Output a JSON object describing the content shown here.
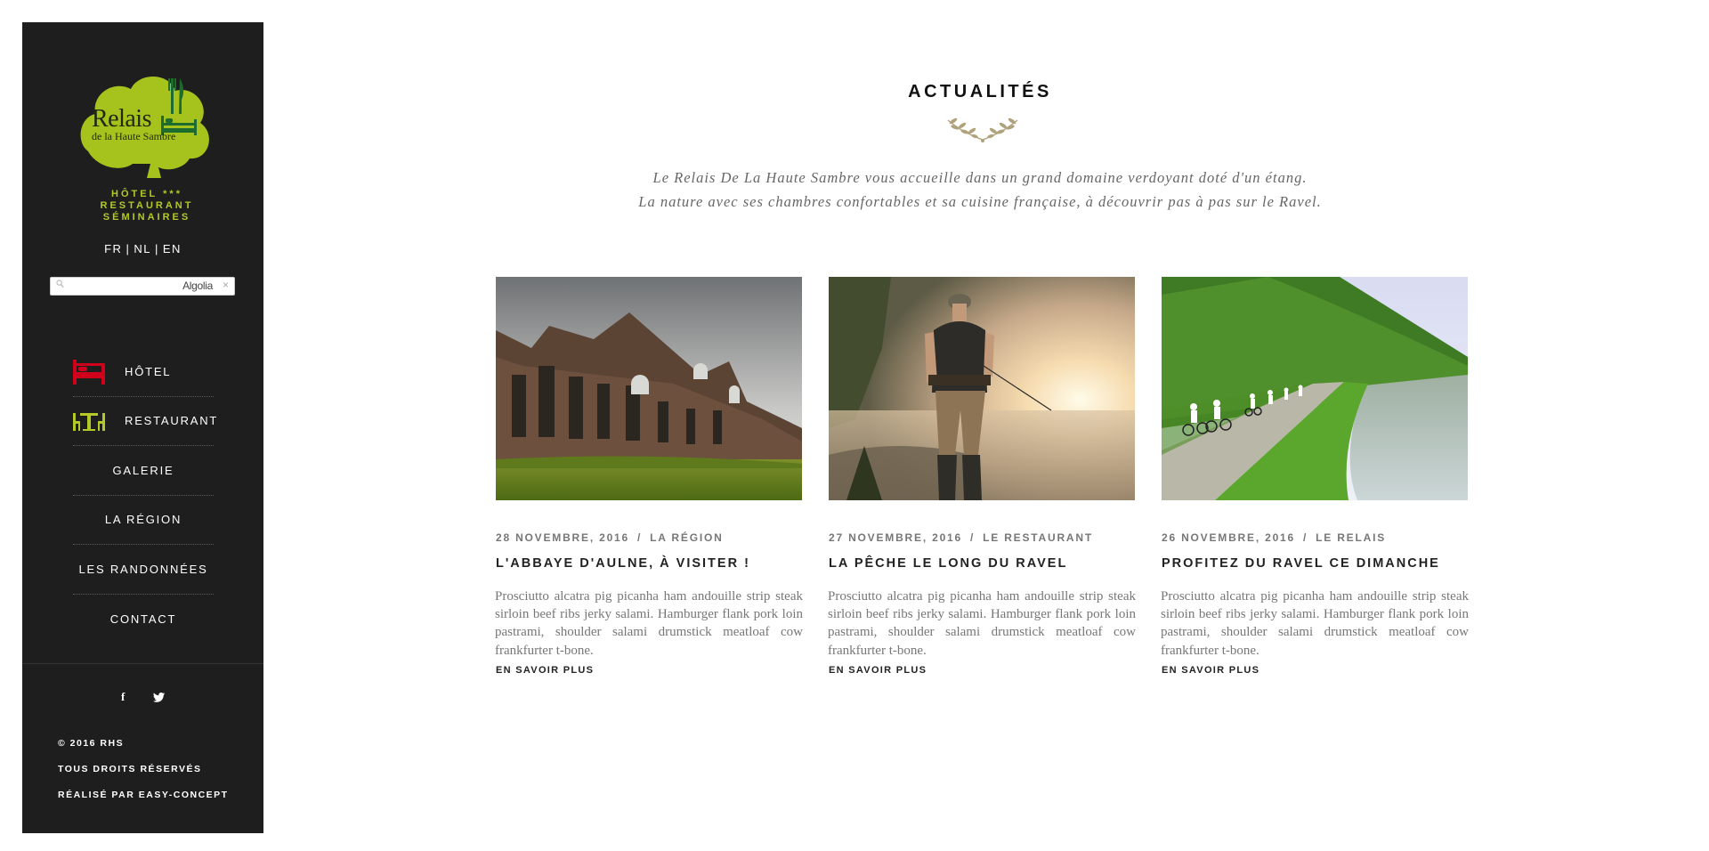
{
  "brand": {
    "logo_main": "Relais",
    "logo_sub": "de la Haute Sambre",
    "tags": [
      "HÔTEL ***",
      "RESTAURANT",
      "SÉMINAIRES"
    ]
  },
  "languages": [
    "FR",
    "NL",
    "EN"
  ],
  "search": {
    "placeholder": "",
    "provider_label": "Algolia",
    "clear_glyph": "×"
  },
  "nav": {
    "items": [
      {
        "label": "HÔTEL",
        "icon": "bed-icon"
      },
      {
        "label": "RESTAURANT",
        "icon": "dining-table-icon"
      },
      {
        "label": "GALERIE"
      },
      {
        "label": "LA RÉGION"
      },
      {
        "label": "LES RANDONNÉES"
      },
      {
        "label": "CONTACT"
      }
    ]
  },
  "social": {
    "facebook": "f",
    "twitter": "twitter-icon"
  },
  "footer": {
    "copyright": "© 2016 RHS",
    "rights": "TOUS DROITS RÉSERVÉS",
    "credit": "RÉALISÉ PAR EASY-CONCEPT"
  },
  "colors": {
    "sidebar_bg": "#1e1e1e",
    "logo_green": "#a6c21c",
    "accent_red": "#d0021b",
    "accent_lime": "#b4c928",
    "laurel": "#b0a27c"
  },
  "section": {
    "title": "ACTUALITÉS",
    "intro": [
      "Le Relais De La Haute Sambre vous accueille dans un grand domaine verdoyant doté d'un étang.",
      "La nature avec ses chambres confortables et sa cuisine française, à découvrir pas à pas sur le Ravel."
    ]
  },
  "posts": [
    {
      "date": "28 NOVEMBRE, 2016",
      "separator": "/",
      "category": "LA RÉGION",
      "title": "L'ABBAYE D'AULNE, À VISITER !",
      "excerpt": "Prosciutto alcatra pig picanha ham andouille strip steak sirloin beef ribs jerky salami. Hamburger flank pork loin pastrami, shoulder salami drumstick meatloaf cow frankfurter t-bone.",
      "more": "EN SAVOIR PLUS",
      "image": "abbey-ruins"
    },
    {
      "date": "27 NOVEMBRE, 2016",
      "separator": "/",
      "category": "LE RESTAURANT",
      "title": "LA PÊCHE LE LONG DU RAVEL",
      "excerpt": "Prosciutto alcatra pig picanha ham andouille strip steak sirloin beef ribs jerky salami. Hamburger flank pork loin pastrami, shoulder salami drumstick meatloaf cow frankfurter t-bone.",
      "more": "EN SAVOIR PLUS",
      "image": "fisherman-sunrise"
    },
    {
      "date": "26 NOVEMBRE, 2016",
      "separator": "/",
      "category": "LE RELAIS",
      "title": "PROFITEZ DU RAVEL CE DIMANCHE",
      "excerpt": "Prosciutto alcatra pig picanha ham andouille strip steak sirloin beef ribs jerky salami. Hamburger flank pork loin pastrami, shoulder salami drumstick meatloaf cow frankfurter t-bone.",
      "more": "EN SAVOIR PLUS",
      "image": "cyclists-canal"
    }
  ]
}
